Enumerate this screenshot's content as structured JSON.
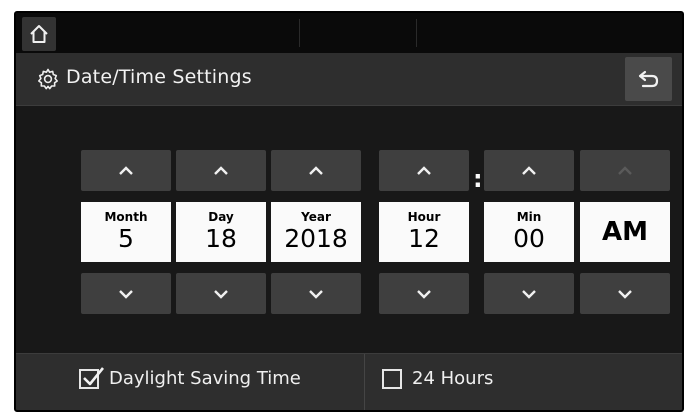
{
  "header": {
    "title": "Date/Time Settings"
  },
  "fields": {
    "month": {
      "label": "Month",
      "value": "5"
    },
    "day": {
      "label": "Day",
      "value": "18"
    },
    "year": {
      "label": "Year",
      "value": "2018"
    },
    "hour": {
      "label": "Hour",
      "value": "12"
    },
    "min": {
      "label": "Min",
      "value": "00"
    },
    "ampm": {
      "value": "AM"
    }
  },
  "time_separator": ":",
  "footer": {
    "daylight_saving": {
      "label": "Daylight Saving Time",
      "checked": true
    },
    "hours_24": {
      "label": "24 Hours",
      "checked": false
    }
  },
  "icons": {
    "home": "home-icon",
    "settings": "gear-icon",
    "back": "back-arrow-icon",
    "up": "chevron-up-icon",
    "down": "chevron-down-icon",
    "check": "checkmark-icon"
  }
}
